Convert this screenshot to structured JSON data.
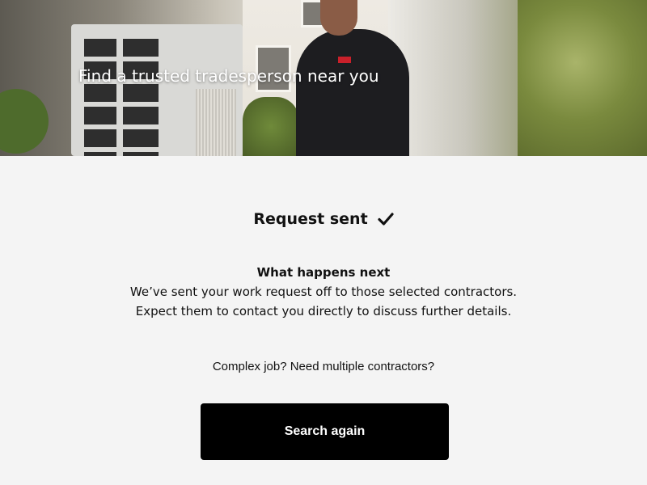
{
  "hero": {
    "title": "Find a trusted tradesperson near you"
  },
  "confirmation": {
    "status_title": "Request sent",
    "status_icon": "check-icon",
    "next_heading": "What happens next",
    "next_line_1": "We’ve sent your work request off to those selected contractors.",
    "next_line_2": "Expect them to contact you directly to discuss further details."
  },
  "cta": {
    "prompt": "Complex job? Need multiple contractors?",
    "button_label": "Search again"
  },
  "colors": {
    "background": "#f4f4f4",
    "button_bg": "#000000",
    "button_text": "#ffffff",
    "text": "#111111"
  }
}
